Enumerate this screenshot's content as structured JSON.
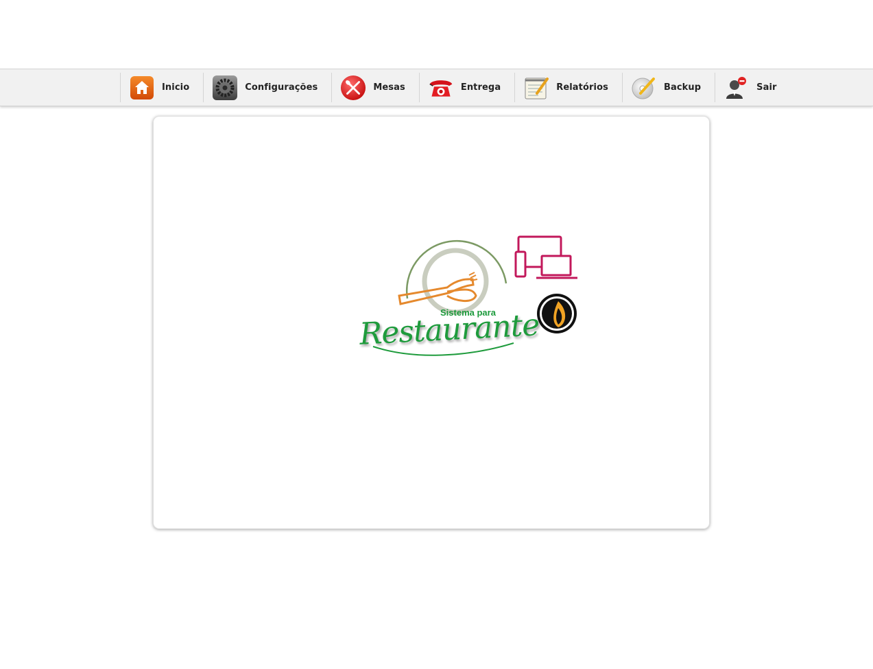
{
  "nav": {
    "items": [
      {
        "label": "Inicio",
        "icon": "home-icon"
      },
      {
        "label": "Configurações",
        "icon": "gear-icon"
      },
      {
        "label": "Mesas",
        "icon": "cutlery-icon"
      },
      {
        "label": "Entrega",
        "icon": "telephone-icon"
      },
      {
        "label": "Relatórios",
        "icon": "notepad-icon"
      },
      {
        "label": "Backup",
        "icon": "disc-icon"
      },
      {
        "label": "Sair",
        "icon": "user-logout-icon"
      }
    ]
  },
  "logo": {
    "subtitle": "Sistema para",
    "title": "Restaurante",
    "colors": {
      "green": "#1e9b3c",
      "orange": "#e5892d",
      "magenta": "#c2185b"
    }
  }
}
